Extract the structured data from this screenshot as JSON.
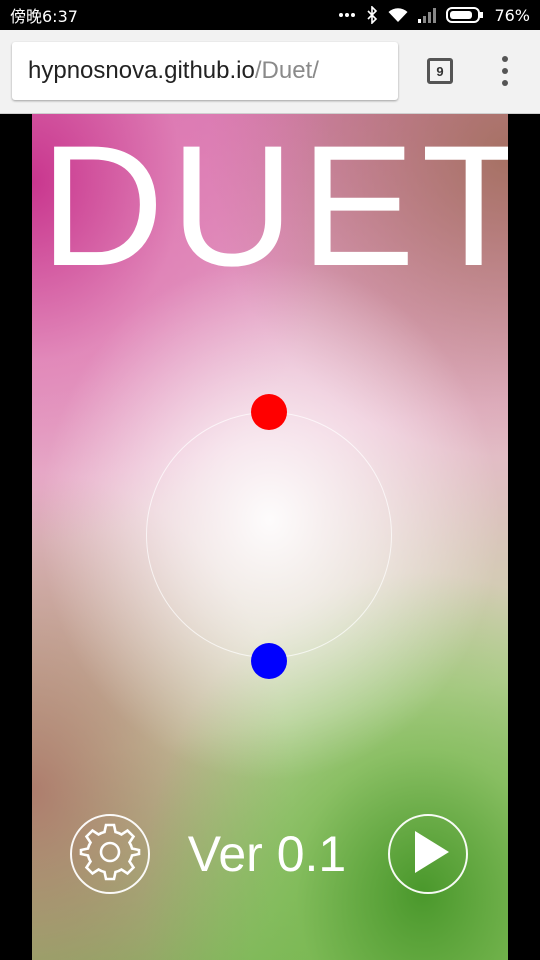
{
  "statusbar": {
    "time": "傍晚6:37",
    "battery": "76%",
    "icons": [
      "dots-icon",
      "bluetooth-icon",
      "wifi-icon",
      "signal-icon",
      "battery-icon"
    ]
  },
  "browser": {
    "url_host": "hypnosnova.github.io",
    "url_path": "/Duet/",
    "tab_count": "9",
    "menu_icon": "overflow-menu-icon"
  },
  "game": {
    "title": "DUET",
    "version": "Ver 0.1",
    "dot_colors": {
      "red": "#ff0000",
      "blue": "#0000ff"
    },
    "settings_icon": "gear-icon",
    "play_icon": "play-icon"
  }
}
